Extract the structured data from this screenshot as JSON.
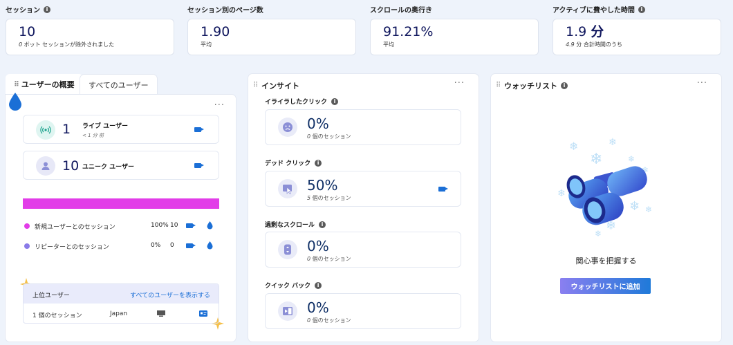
{
  "metrics": [
    {
      "title": "セッション",
      "has_info": true,
      "value": "10",
      "unit": "",
      "sub_num": "0",
      "sub_text": " ボット セッションが除外されました"
    },
    {
      "title": "セッション別のページ数",
      "has_info": false,
      "value": "1.90",
      "unit": "",
      "sub_num": "",
      "sub_text": "平均"
    },
    {
      "title": "スクロールの奥行き",
      "has_info": false,
      "value": "91.21%",
      "unit": "",
      "sub_num": "",
      "sub_text": "平均"
    },
    {
      "title": "アクティブに費やした時間",
      "has_info": true,
      "value": "1.9 ",
      "unit": "分",
      "sub_num": "4.9",
      "sub_text": " 分 合計時間のうち"
    }
  ],
  "users_panel": {
    "tab_active": "ユーザーの概要",
    "tab_inactive": "すべてのユーザー",
    "live": {
      "count": "1",
      "label": "ライブ ユーザー",
      "sub": "< 1 分 前"
    },
    "unique": {
      "count": "10",
      "label": "ユニーク ユーザー"
    },
    "new_share": 1.0,
    "legend": [
      {
        "label": "新規ユーザーとのセッション",
        "pct": "100%",
        "count": "10",
        "color": "#e23de8"
      },
      {
        "label": "リピーターとのセッション",
        "pct": "0%",
        "count": "0",
        "color": "#8a7be8"
      }
    ],
    "top_users": {
      "title": "上位ユーザー",
      "link": "すべてのユーザーを表示する",
      "row": {
        "sessions": "1 個のセッション",
        "country": "Japan"
      }
    }
  },
  "insights_panel": {
    "title": "インサイト",
    "items": [
      {
        "label": "イライラしたクリック",
        "value": "0%",
        "sub_num": "0",
        "sub_text": " 個のセッション",
        "has_cam": false
      },
      {
        "label": "デッド クリック",
        "value": "50%",
        "sub_num": "5",
        "sub_text": " 個のセッション",
        "has_cam": true
      },
      {
        "label": "過剰なスクロール",
        "value": "0%",
        "sub_num": "0",
        "sub_text": " 個のセッション",
        "has_cam": false
      },
      {
        "label": "クイック バック",
        "value": "0%",
        "sub_num": "0",
        "sub_text": " 個のセッション",
        "has_cam": false
      }
    ]
  },
  "watchlist_panel": {
    "title": "ウォッチリスト",
    "message": "関心事を把握する",
    "button": "ウォッチリストに追加"
  },
  "colors": {
    "accent": "#1b6fd6",
    "bar": "#e23de8",
    "button_start": "#8a7ff0",
    "button_end": "#1f7ad9"
  }
}
